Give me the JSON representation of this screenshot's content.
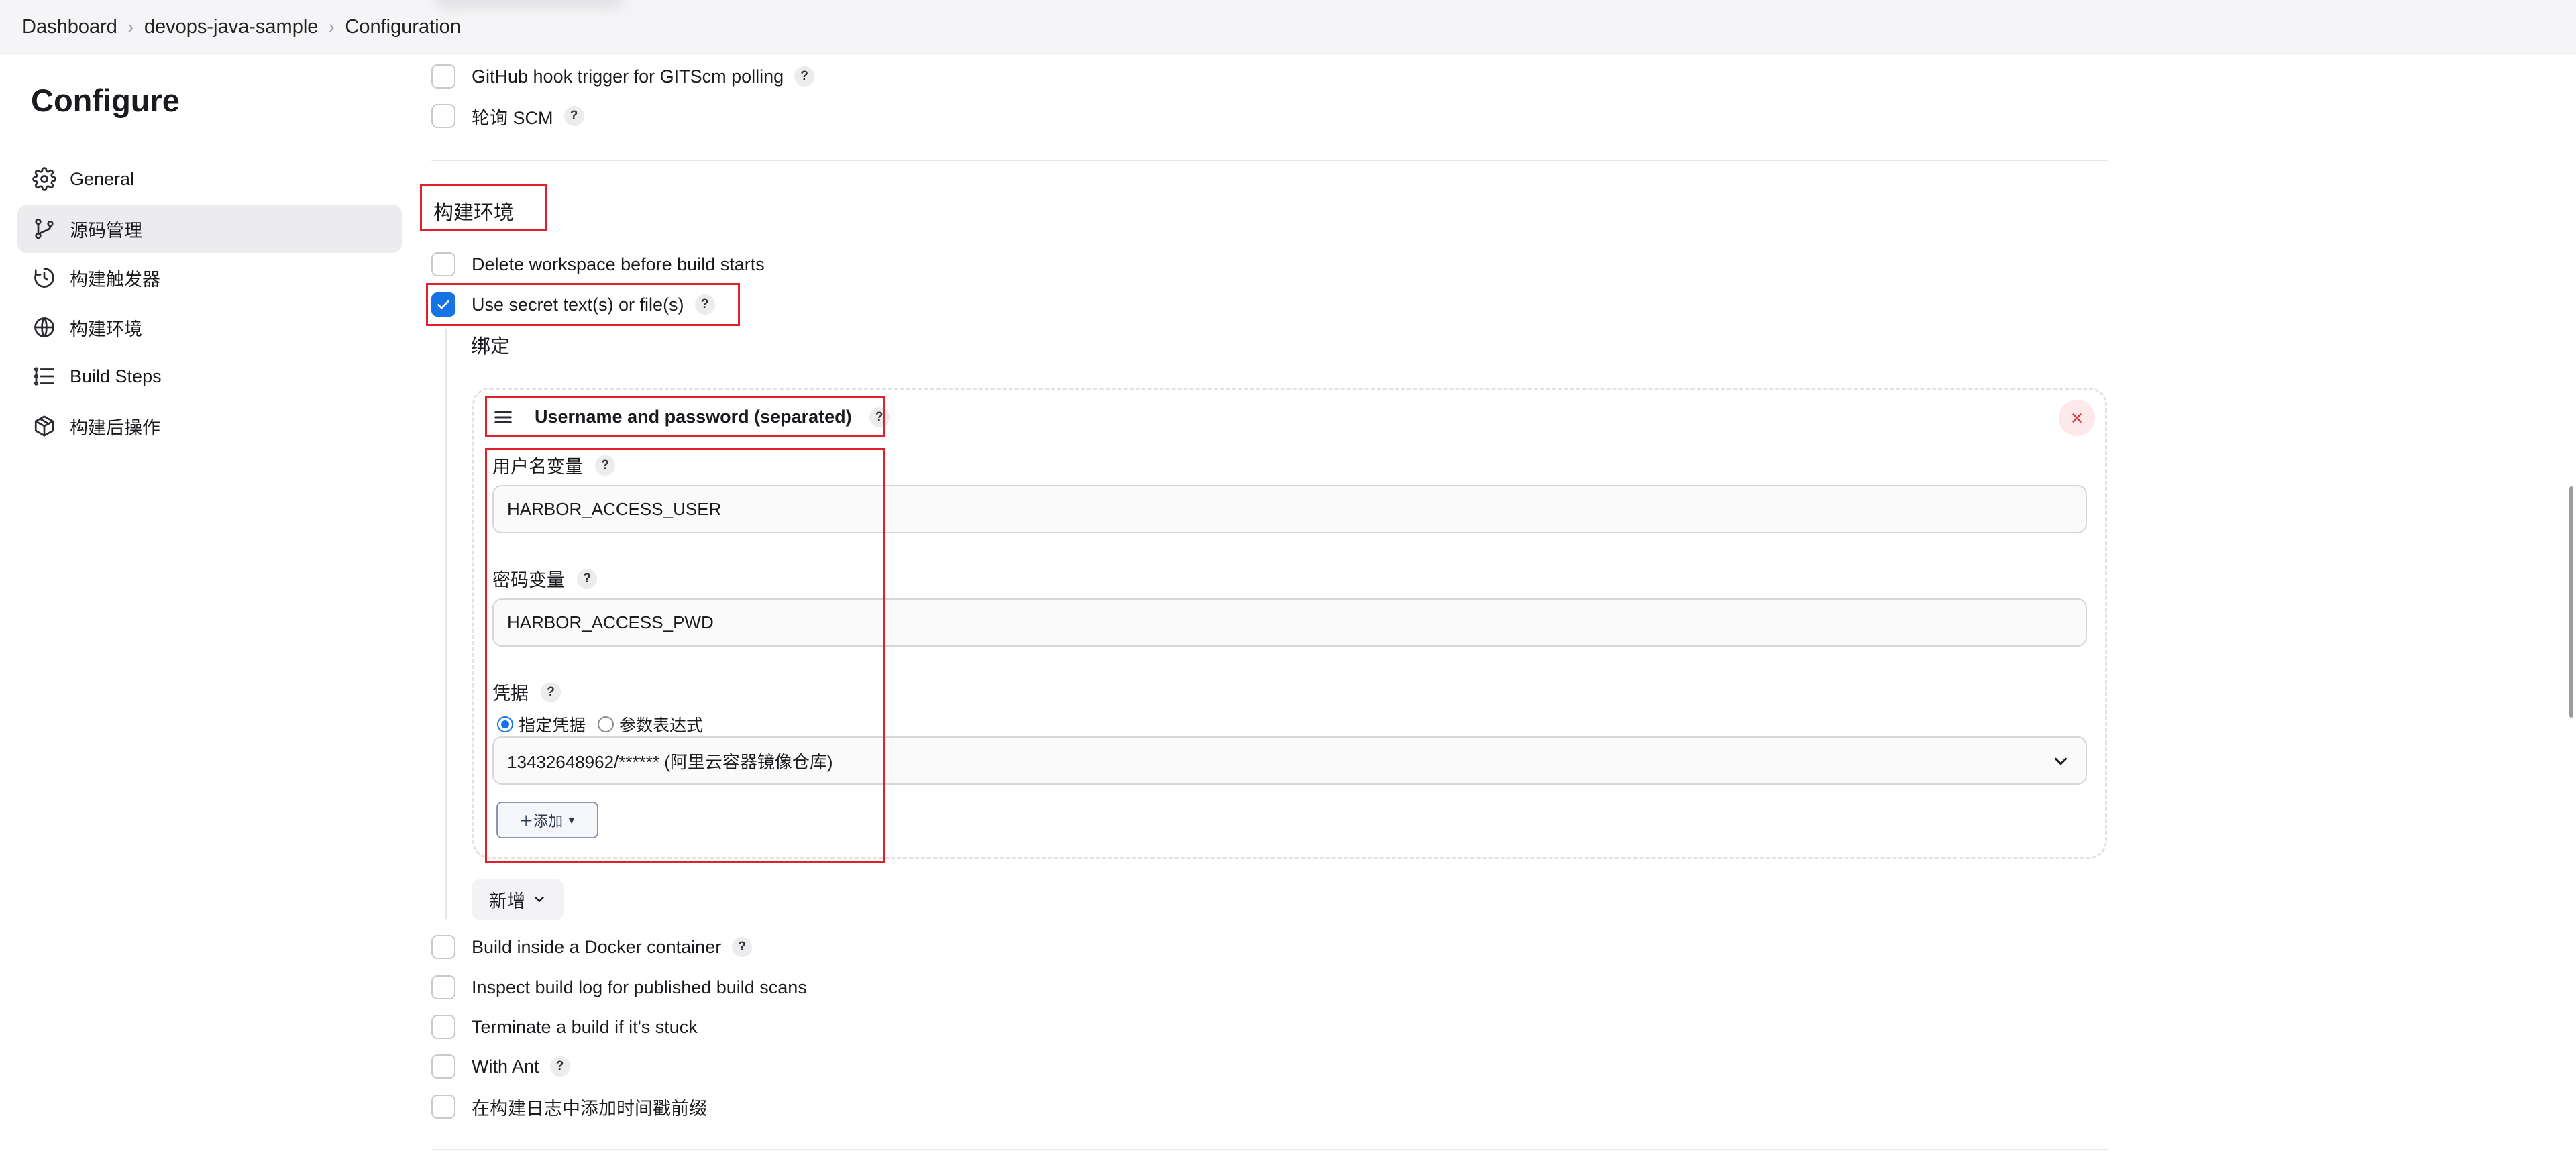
{
  "breadcrumb": [
    "Dashboard",
    "devops-java-sample",
    "Configuration"
  ],
  "sidebar": {
    "title": "Configure",
    "items": [
      {
        "label": "General",
        "icon": "gear-icon"
      },
      {
        "label": "源码管理",
        "icon": "branch-icon"
      },
      {
        "label": "构建触发器",
        "icon": "clock-icon"
      },
      {
        "label": "构建环境",
        "icon": "globe-icon"
      },
      {
        "label": "Build Steps",
        "icon": "list-icon"
      },
      {
        "label": "构建后操作",
        "icon": "cube-icon"
      }
    ],
    "active_index": 1
  },
  "triggers": [
    {
      "label": "GitHub hook trigger for GITScm polling",
      "checked": false,
      "help": "?"
    },
    {
      "label": "轮询 SCM",
      "checked": false,
      "help": "?"
    }
  ],
  "build_env": {
    "title": "构建环境",
    "delete_workspace": {
      "label": "Delete workspace before build starts",
      "checked": false
    },
    "use_secret": {
      "label": "Use secret text(s) or file(s)",
      "checked": true,
      "help": "?"
    },
    "bindings_label": "绑定",
    "binding_card": {
      "title": "Username and password (separated)",
      "help": "?",
      "username_var": {
        "label": "用户名变量",
        "help": "?",
        "value": "HARBOR_ACCESS_USER"
      },
      "password_var": {
        "label": "密码变量",
        "help": "?",
        "value": "HARBOR_ACCESS_PWD"
      },
      "credentials": {
        "label": "凭据",
        "help": "?",
        "radio_specific": "指定凭据",
        "radio_expression": "参数表达式",
        "selected_radio": "specific",
        "selected_value": "13432648962/****** (阿里云容器镜像仓库)"
      },
      "add_button": "＋添加"
    },
    "new_button": "新增"
  },
  "more_options": [
    {
      "label": "Build inside a Docker container",
      "checked": false,
      "help": "?"
    },
    {
      "label": "Inspect build log for published build scans",
      "checked": false
    },
    {
      "label": "Terminate a build if it's stuck",
      "checked": false
    },
    {
      "label": "With Ant",
      "checked": false,
      "help": "?"
    },
    {
      "label": "在构建日志中添加时间戳前缀",
      "checked": false
    }
  ],
  "colors": {
    "accent": "#1474e6",
    "highlight_red": "#e0202a",
    "danger": "#d9303b"
  }
}
